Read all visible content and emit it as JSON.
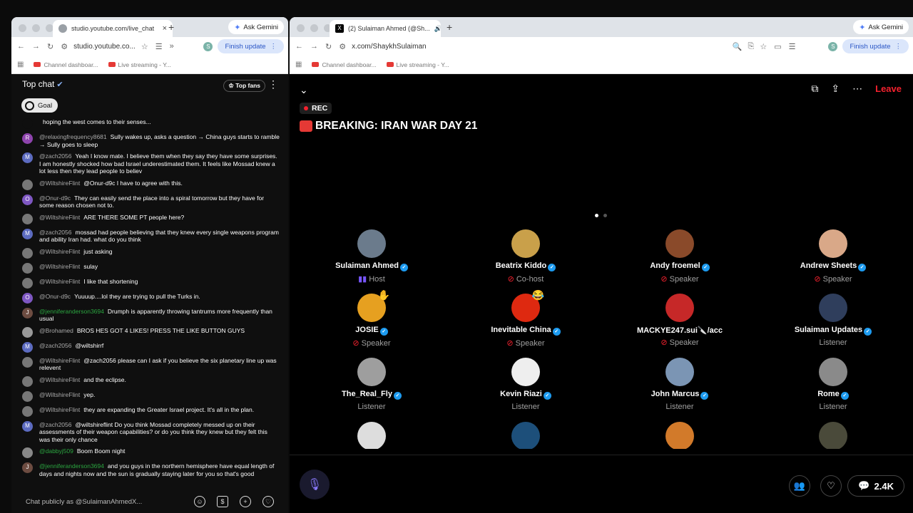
{
  "left_browser": {
    "tab_title": "studio.youtube.com/live_chat",
    "url": "studio.youtube.co...",
    "ask_gemini": "Ask Gemini",
    "finish_update": "Finish update",
    "profile_initial": "S",
    "bookmarks": [
      "Channel dashboar...",
      "Live streaming - Y..."
    ]
  },
  "chat": {
    "title": "Top chat",
    "top_fans": "Top fans",
    "goal": "Goal",
    "input_placeholder": "Chat publicly as @SulaimanAhmedX...",
    "messages": [
      {
        "user": "",
        "text": "hoping the west comes to their senses...",
        "avatar": "",
        "avatar_color": "#0f0f0f"
      },
      {
        "user": "@relaxingfrequency8681",
        "text": "Sully wakes up, asks a question → China guys starts to ramble → Sully goes to sleep",
        "avatar": "R",
        "avatar_color": "#8e44ad"
      },
      {
        "user": "@zach2056",
        "text": "Yeah I know mate. I believe them when they say they have some surprises. I am honestly shocked how bad Israel underestimated them. It feels like Mossad knew a lot less then they lead people to believ",
        "avatar": "M",
        "avatar_color": "#5c6bc0"
      },
      {
        "user": "@WiltshireFlint",
        "text": "@Onur-d9c I have to agree with this.",
        "avatar": "",
        "avatar_color": "#777"
      },
      {
        "user": "@Onur-d9c",
        "text": "They can easily send the place into a spiral tomorrow but they have for some reason chosen not to.",
        "avatar": "O",
        "avatar_color": "#7e57c2"
      },
      {
        "user": "@WiltshireFlint",
        "text": "ARE THERE SOME PT people here?",
        "avatar": "",
        "avatar_color": "#777"
      },
      {
        "user": "@zach2056",
        "text": "mossad had people believing that they knew every single weapons program and ability Iran had. what do you think",
        "avatar": "M",
        "avatar_color": "#5c6bc0"
      },
      {
        "user": "@WiltshireFlint",
        "text": "just asking",
        "avatar": "",
        "avatar_color": "#777"
      },
      {
        "user": "@WiltshireFlint",
        "text": "sulay",
        "avatar": "",
        "avatar_color": "#777"
      },
      {
        "user": "@WiltshireFlint",
        "text": "I like that shortening",
        "avatar": "",
        "avatar_color": "#777"
      },
      {
        "user": "@Onur-d9c",
        "text": "Yuuuup....lol they are trying to pull the Turks in.",
        "avatar": "O",
        "avatar_color": "#7e57c2"
      },
      {
        "user": "@jenniferanderson3694",
        "text": "Drumph is apparently throwing tantrums more frequently than usual",
        "avatar": "J",
        "avatar_color": "#6d4c41",
        "green": true
      },
      {
        "user": "@Brohamed",
        "text": "BROS HES GOT 4 LIKES! PRESS THE LIKE BUTTON GUYS",
        "avatar": "",
        "avatar_color": "#999"
      },
      {
        "user": "@zach2056",
        "text": "@wiltshirrf",
        "avatar": "M",
        "avatar_color": "#5c6bc0"
      },
      {
        "user": "@WiltshireFlint",
        "text": "@zach2056 please can I ask if you believe the six planetary line up was relevent",
        "avatar": "",
        "avatar_color": "#777"
      },
      {
        "user": "@WiltshireFlint",
        "text": "and the eclipse.",
        "avatar": "",
        "avatar_color": "#777"
      },
      {
        "user": "@WiltshireFlint",
        "text": "yep.",
        "avatar": "",
        "avatar_color": "#777"
      },
      {
        "user": "@WiltshireFlint",
        "text": "they are expanding the Greater Israel project. It's all in the plan.",
        "avatar": "",
        "avatar_color": "#777"
      },
      {
        "user": "@zach2056",
        "text": "@wiltshireflint Do you think Mossad completely messed up on their assessments of their weapon capabilities? or do you think they knew but they felt this was their only chance",
        "avatar": "M",
        "avatar_color": "#5c6bc0"
      },
      {
        "user": "@dabbyj509",
        "text": "Boom Boom night",
        "avatar": "",
        "avatar_color": "#888",
        "green": true
      },
      {
        "user": "@jenniferanderson3694",
        "text": "and you guys in the northern hemisphere have equal length of days and nights now and the sun is gradually staying later for you so that's good",
        "avatar": "J",
        "avatar_color": "#6d4c41",
        "green": true
      }
    ]
  },
  "right_browser": {
    "tab_title": "(2) Sulaiman Ahmed (@Sh...",
    "url": "x.com/ShaykhSulaiman",
    "ask_gemini": "Ask Gemini",
    "finish_update": "Finish update",
    "profile_initial": "S",
    "bookmarks": [
      "Channel dashboar...",
      "Live streaming - Y..."
    ]
  },
  "space": {
    "leave": "Leave",
    "rec": "REC",
    "title": "BREAKING: IRAN WAR DAY 21",
    "listener_count": "2.4K",
    "people": [
      {
        "name": "Sulaiman Ahmed",
        "role": "Host",
        "verified": true,
        "color": "#6b7b8c"
      },
      {
        "name": "Beatrix Kiddo",
        "role": "Co-host",
        "verified": true,
        "color": "#c9a04a"
      },
      {
        "name": "Andy froemel",
        "role": "Speaker",
        "verified": true,
        "color": "#8a4a2a"
      },
      {
        "name": "Andrew Sheets",
        "role": "Speaker",
        "verified": true,
        "color": "#d9a888"
      },
      {
        "name": "JOSIE",
        "role": "Speaker",
        "verified": true,
        "color": "#e6a020"
      },
      {
        "name": "Inevitable China",
        "role": "Speaker",
        "verified": true,
        "color": "#de2910"
      },
      {
        "name": "MACKYE247.sui🔪/acc",
        "role": "Speaker",
        "verified": false,
        "color": "#c62828"
      },
      {
        "name": "Sulaiman Updates",
        "role": "Listener",
        "verified": true,
        "color": "#2f3e5c"
      },
      {
        "name": "The_Real_Fly",
        "role": "Listener",
        "verified": true,
        "color": "#9e9e9e"
      },
      {
        "name": "Kevin Riazi",
        "role": "Listener",
        "verified": true,
        "color": "#eeeeee"
      },
      {
        "name": "John Marcus",
        "role": "Listener",
        "verified": true,
        "color": "#7b95b4"
      },
      {
        "name": "Rome",
        "role": "Listener",
        "verified": true,
        "color": "#8a8a8a"
      },
      {
        "name": "",
        "role": "",
        "verified": false,
        "color": "#dddddd"
      },
      {
        "name": "",
        "role": "",
        "verified": false,
        "color": "#1d4f7a"
      },
      {
        "name": "",
        "role": "",
        "verified": false,
        "color": "#d27a2a"
      },
      {
        "name": "",
        "role": "",
        "verified": false,
        "color": "#4a4a3a"
      }
    ]
  }
}
